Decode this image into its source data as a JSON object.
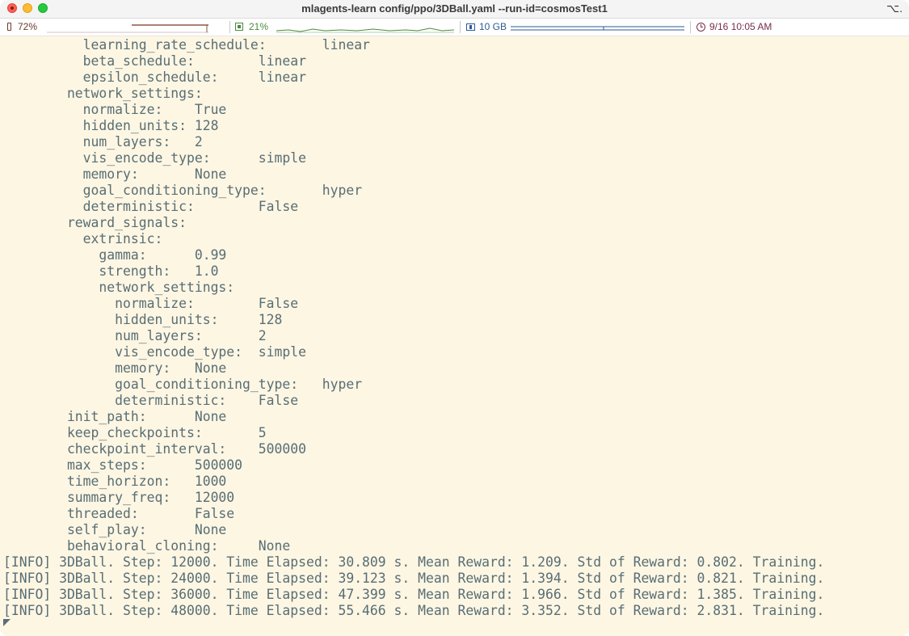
{
  "window": {
    "title": "mlagents-learn config/ppo/3DBall.yaml --run-id=cosmosTest1",
    "option_glyph": "⌥."
  },
  "statusbar": {
    "battery": "72%",
    "cpu": "21%",
    "memory": "10 GB",
    "datetime": "9/16 10:05 AM",
    "colors": {
      "battery": "#6b3a26",
      "cpu": "#4d8a3e",
      "memory": "#2d5a96",
      "clock": "#7a2c4c"
    }
  },
  "terminal": {
    "lines": [
      "          learning_rate_schedule:       linear",
      "          beta_schedule:        linear",
      "          epsilon_schedule:     linear",
      "        network_settings:",
      "          normalize:    True",
      "          hidden_units: 128",
      "          num_layers:   2",
      "          vis_encode_type:      simple",
      "          memory:       None",
      "          goal_conditioning_type:       hyper",
      "          deterministic:        False",
      "        reward_signals:",
      "          extrinsic:",
      "            gamma:      0.99",
      "            strength:   1.0",
      "            network_settings:",
      "              normalize:        False",
      "              hidden_units:     128",
      "              num_layers:       2",
      "              vis_encode_type:  simple",
      "              memory:   None",
      "              goal_conditioning_type:   hyper",
      "              deterministic:    False",
      "        init_path:      None",
      "        keep_checkpoints:       5",
      "        checkpoint_interval:    500000",
      "        max_steps:      500000",
      "        time_horizon:   1000",
      "        summary_freq:   12000",
      "        threaded:       False",
      "        self_play:      None",
      "        behavioral_cloning:     None",
      "[INFO] 3DBall. Step: 12000. Time Elapsed: 30.809 s. Mean Reward: 1.209. Std of Reward: 0.802. Training.",
      "[INFO] 3DBall. Step: 24000. Time Elapsed: 39.123 s. Mean Reward: 1.394. Std of Reward: 0.821. Training.",
      "[INFO] 3DBall. Step: 36000. Time Elapsed: 47.399 s. Mean Reward: 1.966. Std of Reward: 1.385. Training.",
      "[INFO] 3DBall. Step: 48000. Time Elapsed: 55.466 s. Mean Reward: 3.352. Std of Reward: 2.831. Training."
    ]
  },
  "theme": {
    "background": "#fdf6e3",
    "foreground": "#586e75"
  }
}
